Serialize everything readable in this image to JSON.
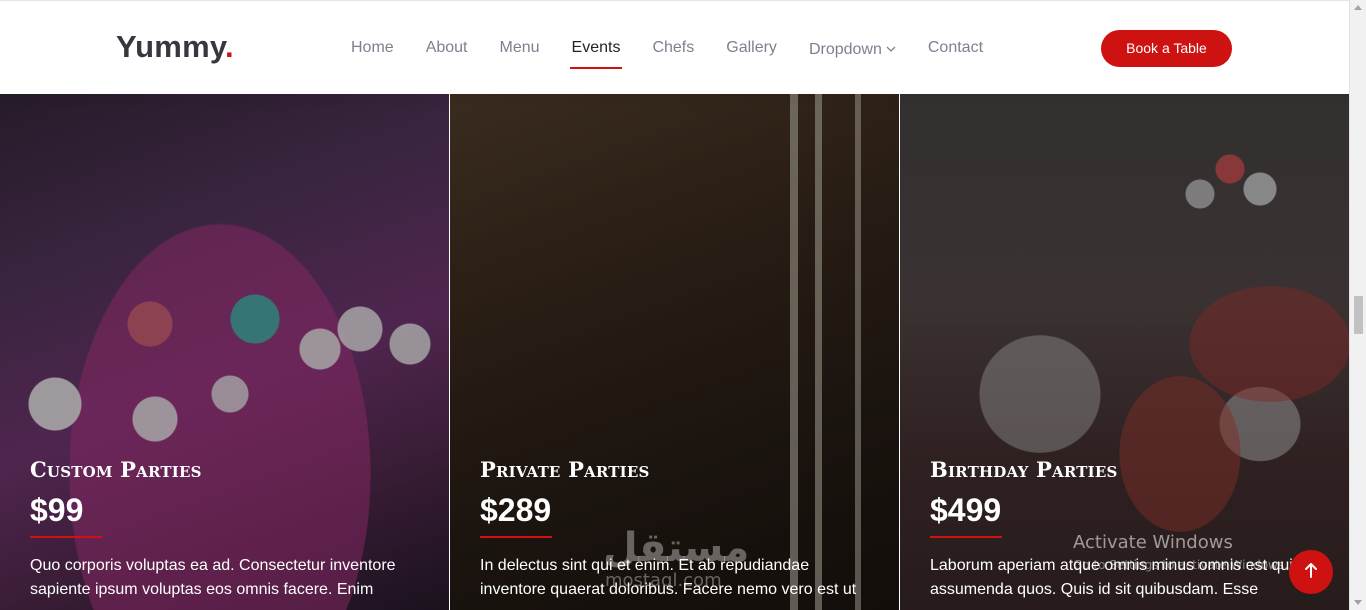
{
  "header": {
    "logo_text": "Yummy",
    "logo_dot": ".",
    "nav": [
      {
        "label": "Home"
      },
      {
        "label": "About"
      },
      {
        "label": "Menu"
      },
      {
        "label": "Events",
        "active": true
      },
      {
        "label": "Chefs"
      },
      {
        "label": "Gallery"
      },
      {
        "label": "Dropdown",
        "has_caret": true
      },
      {
        "label": "Contact"
      }
    ],
    "cta_label": "Book a Table"
  },
  "events": [
    {
      "title": "Custom Parties",
      "price": "$99",
      "description": "Quo corporis voluptas ea ad. Consectetur inventore sapiente ipsum voluptas eos omnis facere. Enim"
    },
    {
      "title": "Private Parties",
      "price": "$289",
      "description": "In delectus sint qui et enim. Et ab repudiandae inventore quaerat doloribus. Facere nemo vero est ut"
    },
    {
      "title": "Birthday Parties",
      "price": "$499",
      "description": "Laborum aperiam atque omnis minus omnis est qui assumenda quos. Quis id sit quibusdam. Esse"
    }
  ],
  "watermark": {
    "brand": "مستقل",
    "sub": "mostaql.com"
  },
  "os_notice": {
    "title": "Activate Windows",
    "subtitle": "Go to Settings to activate Windows."
  },
  "icons": {
    "scroll_top": "arrow-up-icon",
    "dropdown_caret": "chevron-down-icon"
  },
  "colors": {
    "accent": "#ce1212",
    "nav_text": "#7f7f90",
    "nav_active": "#212529"
  }
}
